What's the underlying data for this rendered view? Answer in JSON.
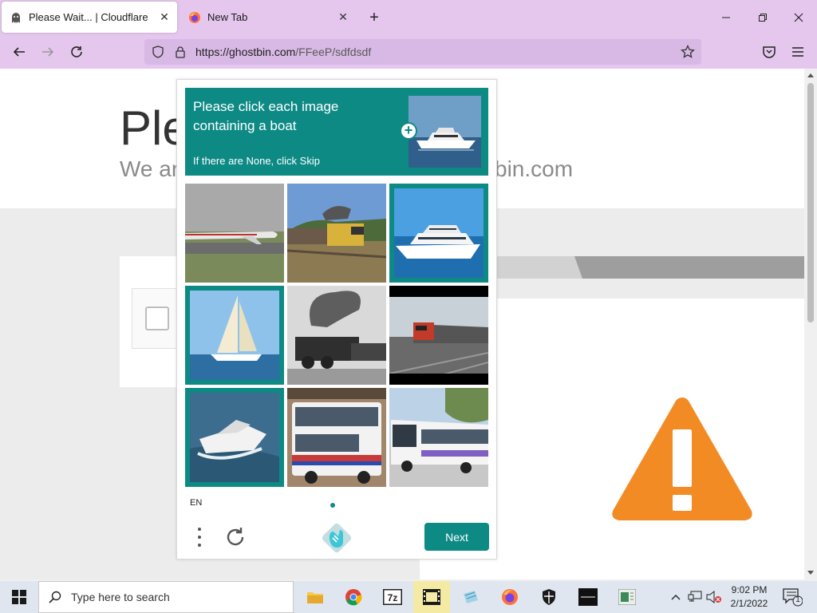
{
  "browser": {
    "tabs": [
      {
        "title": "Please Wait... | Cloudflare",
        "active": true
      },
      {
        "title": "New Tab",
        "active": false
      }
    ],
    "url": {
      "domain": "https://ghostbin.com",
      "path": "/FFeeP/sdfdsdf"
    }
  },
  "page": {
    "heading": "Ple",
    "subheading_left": "We ar",
    "subheading_right": "bin.com"
  },
  "captcha": {
    "title": "Please click each image containing a boat",
    "instruction": "If there are None, click Skip",
    "language": "EN",
    "next_label": "Next",
    "tiles": [
      {
        "content": "airplane",
        "selected": false
      },
      {
        "content": "train",
        "selected": false
      },
      {
        "content": "boat",
        "selected": true
      },
      {
        "content": "sailboat",
        "selected": true
      },
      {
        "content": "steam train",
        "selected": false
      },
      {
        "content": "train",
        "selected": false
      },
      {
        "content": "speedboat",
        "selected": true
      },
      {
        "content": "double-decker bus",
        "selected": false
      },
      {
        "content": "bus",
        "selected": false
      }
    ],
    "accent_color": "#0e8a85"
  },
  "taskbar": {
    "search_placeholder": "Type here to search",
    "time": "9:02 PM",
    "date": "2/1/2022",
    "notification_count": "1"
  }
}
